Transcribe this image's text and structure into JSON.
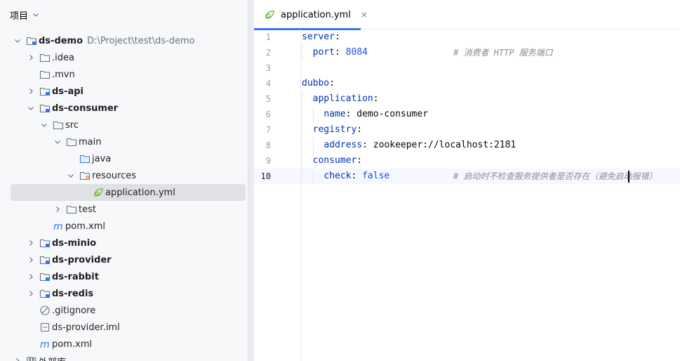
{
  "project_panel": {
    "title": "项目",
    "tree": [
      {
        "label": "ds-demo",
        "path": "D:\\Project\\test\\ds-demo",
        "bold": true,
        "arrow": "down",
        "icon": "module-folder-icon",
        "depth": 0
      },
      {
        "label": ".idea",
        "bold": false,
        "arrow": "right",
        "icon": "folder-icon",
        "depth": 1
      },
      {
        "label": ".mvn",
        "bold": false,
        "arrow": "none",
        "icon": "folder-icon",
        "depth": 1
      },
      {
        "label": "ds-api",
        "bold": true,
        "arrow": "right",
        "icon": "module-folder-icon",
        "depth": 1
      },
      {
        "label": "ds-consumer",
        "bold": true,
        "arrow": "down",
        "icon": "module-folder-icon",
        "depth": 1
      },
      {
        "label": "src",
        "bold": false,
        "arrow": "down",
        "icon": "folder-icon",
        "depth": 2
      },
      {
        "label": "main",
        "bold": false,
        "arrow": "down",
        "icon": "folder-icon",
        "depth": 3
      },
      {
        "label": "java",
        "bold": false,
        "arrow": "none",
        "icon": "source-folder-icon",
        "depth": 4
      },
      {
        "label": "resources",
        "bold": false,
        "arrow": "down",
        "icon": "resources-folder-icon",
        "depth": 4
      },
      {
        "label": "application.yml",
        "bold": false,
        "arrow": "none",
        "icon": "spring-leaf-icon",
        "depth": 5,
        "selected": true
      },
      {
        "label": "test",
        "bold": false,
        "arrow": "right",
        "icon": "folder-icon",
        "depth": 3
      },
      {
        "label": "pom.xml",
        "bold": false,
        "arrow": "none",
        "icon": "maven-icon",
        "depth": 2
      },
      {
        "label": "ds-minio",
        "bold": true,
        "arrow": "right",
        "icon": "module-folder-icon",
        "depth": 1
      },
      {
        "label": "ds-provider",
        "bold": true,
        "arrow": "right",
        "icon": "module-folder-icon",
        "depth": 1
      },
      {
        "label": "ds-rabbit",
        "bold": true,
        "arrow": "right",
        "icon": "module-folder-icon",
        "depth": 1
      },
      {
        "label": "ds-redis",
        "bold": true,
        "arrow": "right",
        "icon": "module-folder-icon",
        "depth": 1
      },
      {
        "label": ".gitignore",
        "bold": false,
        "arrow": "none",
        "icon": "ignored-file-icon",
        "depth": 1
      },
      {
        "label": "ds-provider.iml",
        "bold": false,
        "arrow": "none",
        "icon": "iml-file-icon",
        "depth": 1
      },
      {
        "label": "pom.xml",
        "bold": false,
        "arrow": "none",
        "icon": "maven-icon",
        "depth": 1
      },
      {
        "label": "外部库",
        "bold": false,
        "arrow": "right",
        "icon": "library-icon",
        "depth": 0
      }
    ]
  },
  "editor": {
    "tab": {
      "label": "application.yml",
      "close": "×",
      "icon": "spring-leaf-icon"
    },
    "current_line": 10,
    "lines": [
      {
        "num": "1",
        "indent": "",
        "key": "server",
        "sep": ":",
        "value": "",
        "value_type": "",
        "comment": ""
      },
      {
        "num": "2",
        "indent": "  ",
        "key": "port",
        "sep": ": ",
        "value": "8084",
        "value_type": "number",
        "comment": "# 消费者 HTTP 服务端口"
      },
      {
        "num": "3",
        "indent": "",
        "key": "",
        "sep": "",
        "value": "",
        "value_type": "",
        "comment": ""
      },
      {
        "num": "4",
        "indent": "",
        "key": "dubbo",
        "sep": ":",
        "value": "",
        "value_type": "",
        "comment": ""
      },
      {
        "num": "5",
        "indent": "  ",
        "key": "application",
        "sep": ":",
        "value": "",
        "value_type": "",
        "comment": ""
      },
      {
        "num": "6",
        "indent": "    ",
        "key": "name",
        "sep": ": ",
        "value": "demo-consumer",
        "value_type": "plain",
        "comment": ""
      },
      {
        "num": "7",
        "indent": "  ",
        "key": "registry",
        "sep": ":",
        "value": "",
        "value_type": "",
        "comment": ""
      },
      {
        "num": "8",
        "indent": "    ",
        "key": "address",
        "sep": ": ",
        "value": "zookeeper://localhost:2181",
        "value_type": "plain",
        "comment": ""
      },
      {
        "num": "9",
        "indent": "  ",
        "key": "consumer",
        "sep": ":",
        "value": "",
        "value_type": "",
        "comment": ""
      },
      {
        "num": "10",
        "indent": "    ",
        "key": "check",
        "sep": ": ",
        "value": "false",
        "value_type": "keyword",
        "comment": "# 启动时不检查服务提供者是否存在（避免启动报错）"
      }
    ]
  },
  "colors": {
    "accent": "#3574f0",
    "yaml_key": "#0033b3",
    "number": "#1750eb",
    "comment": "#8c8c8c",
    "spring_green": "#5fb832"
  }
}
